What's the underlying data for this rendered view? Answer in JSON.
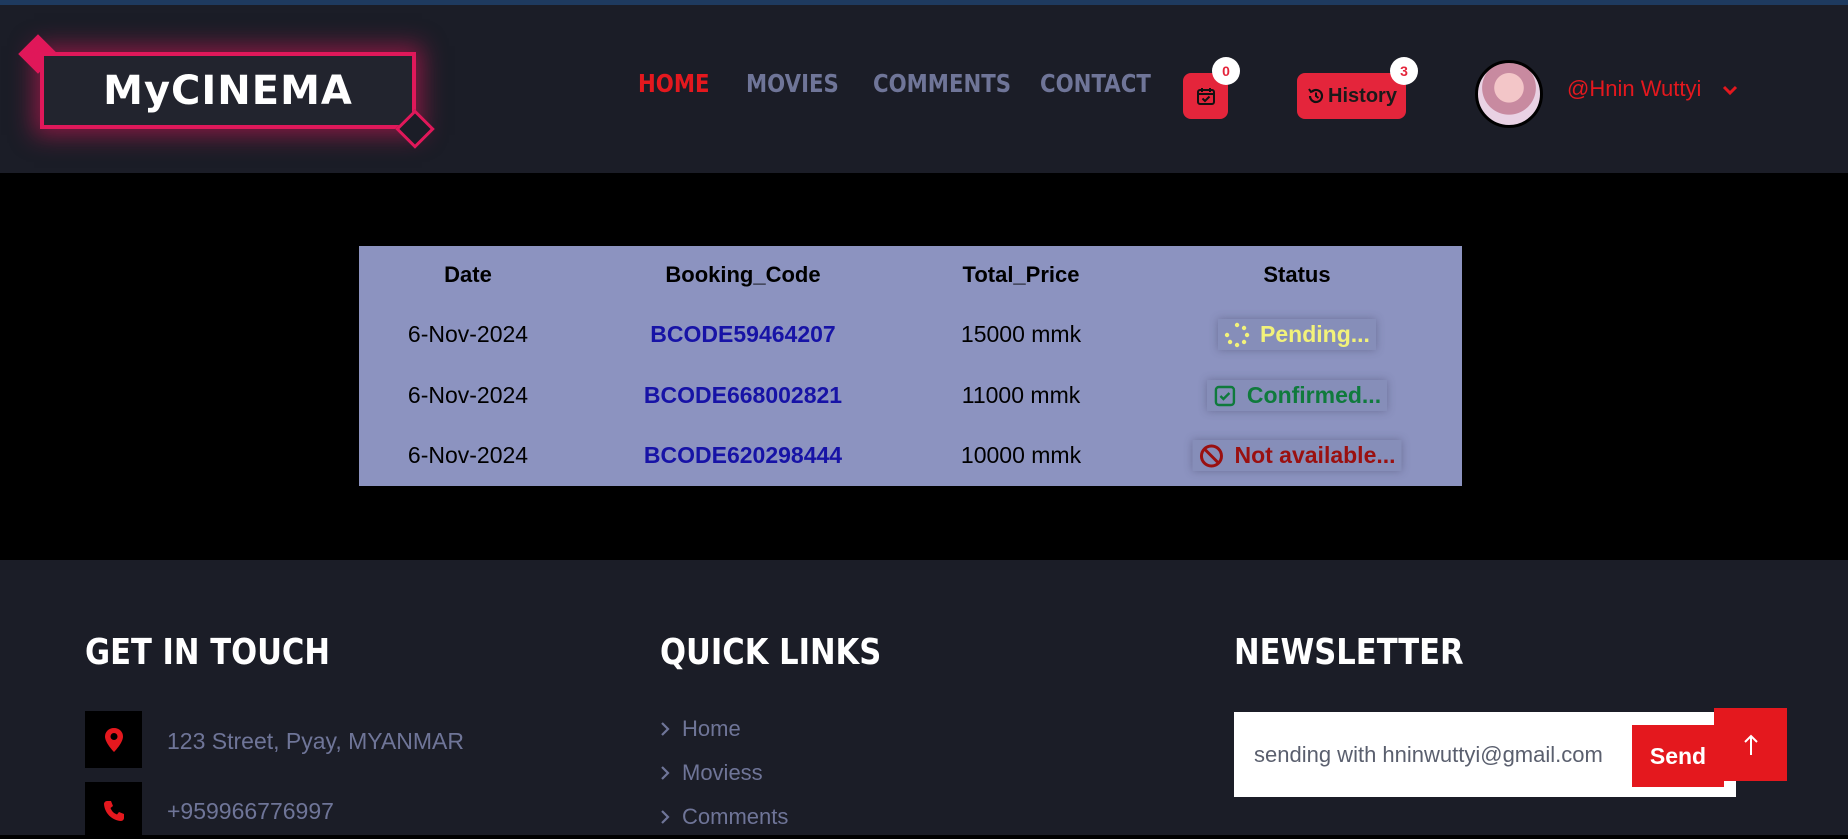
{
  "brand": {
    "logo_text": "MyCINEMA"
  },
  "nav": {
    "items": [
      {
        "label": "HOME",
        "active": true
      },
      {
        "label": "MOVIES",
        "active": false
      },
      {
        "label": "COMMENTS",
        "active": false
      },
      {
        "label": "CONTACT",
        "active": false
      }
    ],
    "cart_badge": "0",
    "history_label": "History",
    "history_badge": "3",
    "username": "@Hnin Wuttyi"
  },
  "bookings": {
    "headers": [
      "Date",
      "Booking_Code",
      "Total_Price",
      "Status"
    ],
    "rows": [
      {
        "date": "6-Nov-2024",
        "code": "BCODE59464207",
        "price": "15000 mmk",
        "status": "Pending...",
        "status_icon": "spinner-icon"
      },
      {
        "date": "6-Nov-2024",
        "code": "BCODE668002821",
        "price": "11000 mmk",
        "status": "Confirmed...",
        "status_icon": "check-square-icon"
      },
      {
        "date": "6-Nov-2024",
        "code": "BCODE620298444",
        "price": "10000 mmk",
        "status": "Not available...",
        "status_icon": "ban-icon"
      }
    ]
  },
  "footer": {
    "contact": {
      "heading": "GET IN TOUCH",
      "address": "123 Street, Pyay, MYANMAR",
      "phone": "+959966776997"
    },
    "links": {
      "heading": "QUICK LINKS",
      "items": [
        "Home",
        "Moviess",
        "Comments"
      ]
    },
    "newsletter": {
      "heading": "NEWSLETTER",
      "input_value": "sending with hninwuttyi@gmail.com",
      "send_label": "Send"
    }
  },
  "colors": {
    "accent": "#e4181e",
    "brand_pink": "#e0185a",
    "table_bg": "#8c93c0",
    "dark_bg": "#1b1d27"
  }
}
